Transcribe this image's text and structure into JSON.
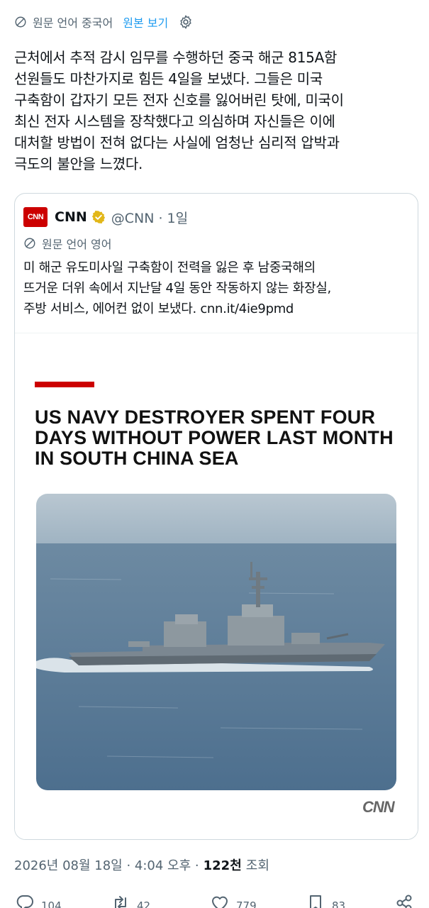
{
  "translation_bar": {
    "label": "원문 언어 중국어",
    "show_original": "원본 보기"
  },
  "tweet": {
    "text": "근처에서 추적 감시 임무를 수행하던 중국 해군 815A함\n선원들도 마찬가지로 힘든 4일을 보냈다. 그들은 미국\n구축함이 갑자기 모든 전자 신호를 잃어버린 탓에, 미국이\n최신 전자 시스템을 장착했다고 의심하며 자신들은 이에\n대처할 방법이 전혀 없다는 사실에 엄청난 심리적 압박과\n극도의 불안을 느꼈다."
  },
  "quote": {
    "logo_text": "CNN",
    "name": "CNN",
    "handle_time": "@CNN · 1일",
    "translation_label": "원문 언어 영어",
    "text": "미 해군 유도미사일 구축함이 전력을 잃은 후 남중국해의\n뜨거운 더위 속에서 지난달 4일 동안 작동하지 않는 화장실,\n주방 서비스, 에어컨 없이 보냈다. cnn.it/4ie9pmd",
    "image": {
      "headline": "US NAVY DESTROYER SPENT FOUR DAYS WITHOUT POWER LAST MONTH IN SOUTH CHINA SEA",
      "watermark": "CNN"
    }
  },
  "meta": {
    "timestamp": "2026년 08월 18일 · 4:04 오후 ·",
    "views": "122천",
    "views_label": "조회"
  },
  "actions": {
    "replies": "104",
    "reposts": "42",
    "likes": "779",
    "bookmarks": "83"
  },
  "colors": {
    "accent": "#1d9bf0",
    "secondary_text": "#536471",
    "cnn_red": "#cc0000"
  }
}
